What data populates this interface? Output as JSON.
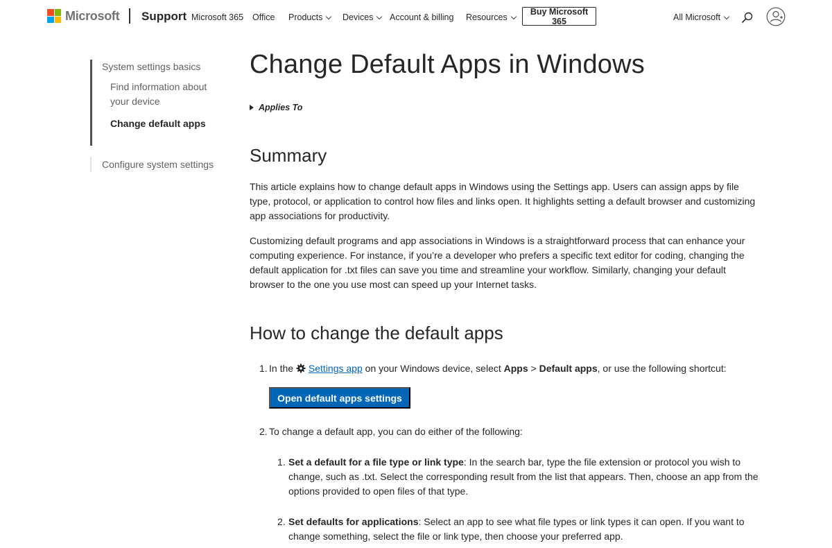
{
  "header": {
    "brand": "Microsoft",
    "support": "Support",
    "nav": [
      {
        "label": "Microsoft 365",
        "dropdown": false
      },
      {
        "label": "Office",
        "dropdown": false
      },
      {
        "label": "Products",
        "dropdown": true
      },
      {
        "label": "Devices",
        "dropdown": true
      },
      {
        "label": "Account & billing",
        "dropdown": false
      },
      {
        "label": "Resources",
        "dropdown": true
      }
    ],
    "buy_button": "Buy Microsoft 365",
    "all_microsoft": "All Microsoft",
    "search_icon": "search-icon",
    "account_icon": "account-icon",
    "logo_colors": [
      "#f25022",
      "#7fba00",
      "#00a4ef",
      "#ffb900"
    ]
  },
  "left_nav": {
    "section": "System settings basics",
    "items": [
      {
        "label": "Find information about your device",
        "active": false
      },
      {
        "label": "Change default apps",
        "active": true
      }
    ],
    "section2": "Configure system settings"
  },
  "main": {
    "title": "Change Default Apps in Windows",
    "applies_to": "Applies To",
    "summary_heading": "Summary",
    "summary_p1": "This article explains how to change default apps in Windows using the Settings app. Users can assign apps by file type, protocol, or application to control how files and links open. It highlights setting a default browser and customizing app associations for productivity.",
    "summary_p2": "Customizing default programs and app associations in Windows is a straightforward process that can enhance your computing experience. For instance, if you’re a developer who prefers a specific text editor for coding, changing the default application for .txt files can save you time and streamline your workflow. Similarly, changing your default browser to the one you use most can speed up your Internet tasks.",
    "howto_heading": "How to change the default apps",
    "step1": {
      "num": "1.",
      "pre": "In the",
      "link": "Settings app",
      "mid": "on your Windows device, select",
      "apps": "Apps",
      "sep": ">",
      "default_apps": "Default apps",
      "post": ", or use the following shortcut:"
    },
    "cta_button": "Open default apps settings",
    "step2": {
      "num": "2.",
      "text": "To change a default app, you can do either of the following:"
    },
    "sub_steps": [
      {
        "num": "1.",
        "bold": "Set a default for a file type or link type",
        "text": ": In the search bar, type the file extension or protocol you wish to change, such as .txt. Select the corresponding result from the list that appears. Then, choose an app from the options provided to open files of that type."
      },
      {
        "num": "2.",
        "bold": "Set defaults for applications",
        "text": ": Select an app to see what file types or link types it can open. If you want to change something, select the file or link type, then choose your preferred app."
      }
    ]
  },
  "colors": {
    "accent": "#0067b8",
    "text": "#262626",
    "muted": "#616161"
  }
}
